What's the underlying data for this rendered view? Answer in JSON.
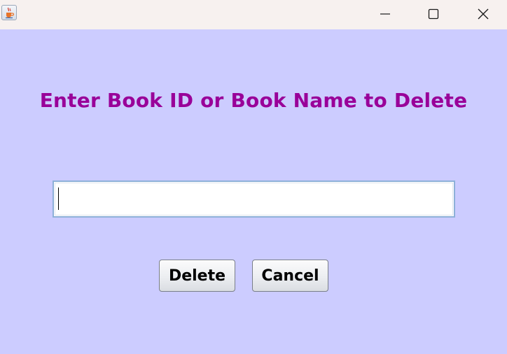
{
  "window": {
    "title": "",
    "icon": "java-cup-icon",
    "controls": {
      "minimize": "minimize-icon",
      "maximize": "maximize-icon",
      "close": "close-icon"
    }
  },
  "form": {
    "prompt": "Enter Book ID or Book Name to Delete",
    "input_value": "",
    "input_placeholder": ""
  },
  "buttons": {
    "delete_label": "Delete",
    "cancel_label": "Cancel"
  },
  "colors": {
    "background": "#ccccff",
    "prompt_text": "#990099",
    "titlebar": "#f7f1ef"
  }
}
